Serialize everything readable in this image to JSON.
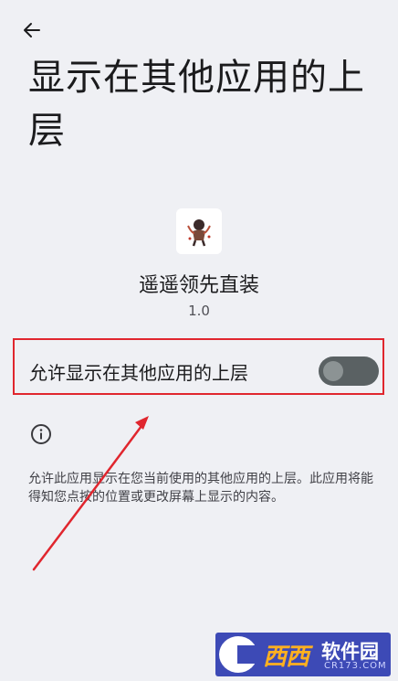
{
  "header": {
    "back_icon": "arrow-back-icon",
    "title": "显示在其他应用的上层"
  },
  "app": {
    "icon": "app-icon",
    "name": "遥遥领先直装",
    "version": "1.0"
  },
  "permission": {
    "label": "允许显示在其他应用的上层",
    "enabled": false
  },
  "info": {
    "icon": "info-icon",
    "description": "允许此应用显示在您当前使用的其他应用的上层。此应用将能得知您点按的位置或更改屏幕上显示的内容。"
  },
  "annotation": {
    "highlight_color": "#e0262e",
    "arrow_color": "#e0262e"
  },
  "watermark": {
    "brand": "西西",
    "site": "软件园",
    "url": "CR173.COM"
  }
}
